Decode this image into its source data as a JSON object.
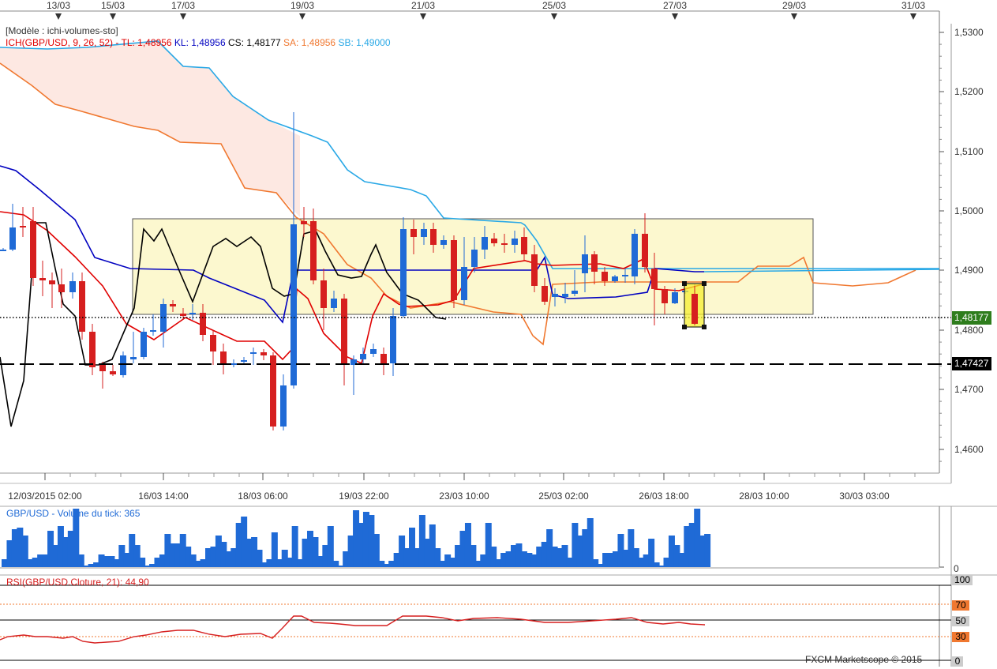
{
  "top_dates": [
    "13/03",
    "15/03",
    "17/03",
    "19/03",
    "21/03",
    "25/03",
    "27/03",
    "29/03",
    "31/03"
  ],
  "main": {
    "model_label": "[Modèle : ichi-volumes-sto]",
    "ich_name": "ICH(GBP/USD, 9, 26, 52) -",
    "tl_label": "TL: 1,48956",
    "kl_label": "KL: 1,48956",
    "cs_label": "CS: 1,48177",
    "sa_label": "SA: 1,48956",
    "sb_label": "SB: 1,49000",
    "price_ticks": [
      "1,5300",
      "1,5200",
      "1,5100",
      "1,5000",
      "1,4900",
      "1,4800",
      "1,4700",
      "1,4600"
    ],
    "current_price": "1,48177",
    "dashed_level": "1,47427",
    "time_ticks": [
      "12/03/2015 02:00",
      "16/03 14:00",
      "18/03 06:00",
      "19/03 22:00",
      "23/03 10:00",
      "25/03 02:00",
      "26/03 18:00",
      "28/03 10:00",
      "30/03 03:00"
    ]
  },
  "volume": {
    "label": "GBP/USD - Volume du tick: 365",
    "axis_zero": "0",
    "values": [
      5,
      17,
      24,
      25,
      20,
      5,
      6,
      8,
      8,
      23,
      14,
      26,
      19,
      23,
      37,
      8,
      1,
      2,
      3,
      8,
      7,
      7,
      5,
      14,
      9,
      21,
      14,
      6,
      1,
      2,
      6,
      8,
      21,
      15,
      15,
      21,
      13,
      8,
      4,
      5,
      12,
      13,
      20,
      16,
      10,
      12,
      28,
      32,
      18,
      19,
      11,
      3,
      5,
      22,
      5,
      11,
      6,
      26,
      5,
      18,
      23,
      19,
      7,
      14,
      26,
      4,
      1,
      10,
      20,
      36,
      28,
      35,
      33,
      21,
      4,
      2,
      4,
      9,
      20,
      12,
      25,
      12,
      33,
      18,
      27,
      12,
      4,
      8,
      6,
      14,
      23,
      28,
      14,
      4,
      8,
      28,
      13,
      5,
      9,
      10,
      14,
      15,
      10,
      9,
      8,
      13,
      16,
      24,
      13,
      12,
      14,
      6,
      28,
      20,
      24,
      31,
      5,
      2,
      9,
      9,
      10,
      21,
      11,
      24,
      12,
      6,
      8,
      18,
      3,
      1,
      6,
      20,
      14,
      9,
      26,
      28,
      37,
      20,
      21,
      6,
      8,
      18,
      0,
      0,
      0,
      0,
      0,
      0,
      0,
      0,
      0
    ]
  },
  "rsi": {
    "label": "RSI(GBP/USD.Cloture, 21): 44,90",
    "levels": {
      "l100": "100",
      "l70": "70",
      "l50": "50",
      "l30": "30",
      "l0": "0"
    }
  },
  "footer": "FXCM Marketscope © 2015",
  "colors": {
    "bull": "#1f6ad6",
    "bear": "#d61f1f",
    "tenkan": "#e00000",
    "kijun": "#0000c0",
    "senkou_a": "#f07830",
    "senkou_b": "#29a8e6",
    "chikou": "#000000",
    "cloud": "#fde8e2",
    "zone": "#fbf5bf",
    "price_box": "#2e7d1d"
  }
}
